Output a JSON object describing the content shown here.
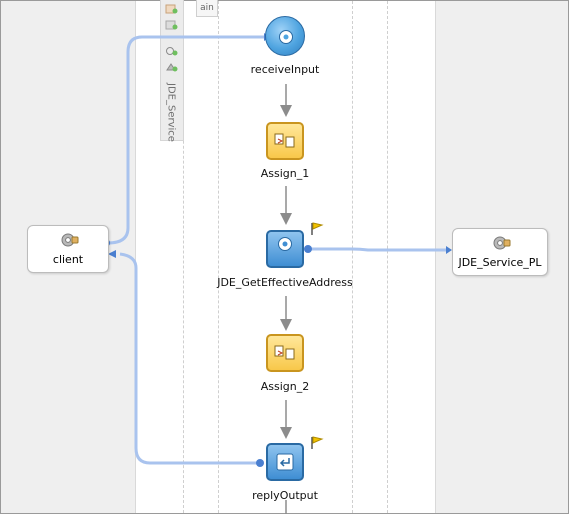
{
  "palette": {
    "vertical_label": "JDE_Service",
    "tab_stub": "ain"
  },
  "partners": {
    "client": {
      "label": "client",
      "icon": "gear-icon"
    },
    "service": {
      "label": "JDE_Service_PL",
      "icon": "gear-icon"
    }
  },
  "activities": {
    "receive": {
      "label": "receiveInput",
      "icon": "gear-icon"
    },
    "assign1": {
      "label": "Assign_1",
      "icon": "assign-icon"
    },
    "invoke": {
      "label": "JDE_GetEffectiveAddress",
      "icon": "gear-icon"
    },
    "assign2": {
      "label": "Assign_2",
      "icon": "assign-icon"
    },
    "reply": {
      "label": "replyOutput",
      "icon": "reply-icon"
    }
  },
  "colors": {
    "link_line": "#a9c3ee",
    "link_end": "#4a7fd0",
    "flow_arrow": "#8c8c8c",
    "flag": "#f2c200"
  }
}
